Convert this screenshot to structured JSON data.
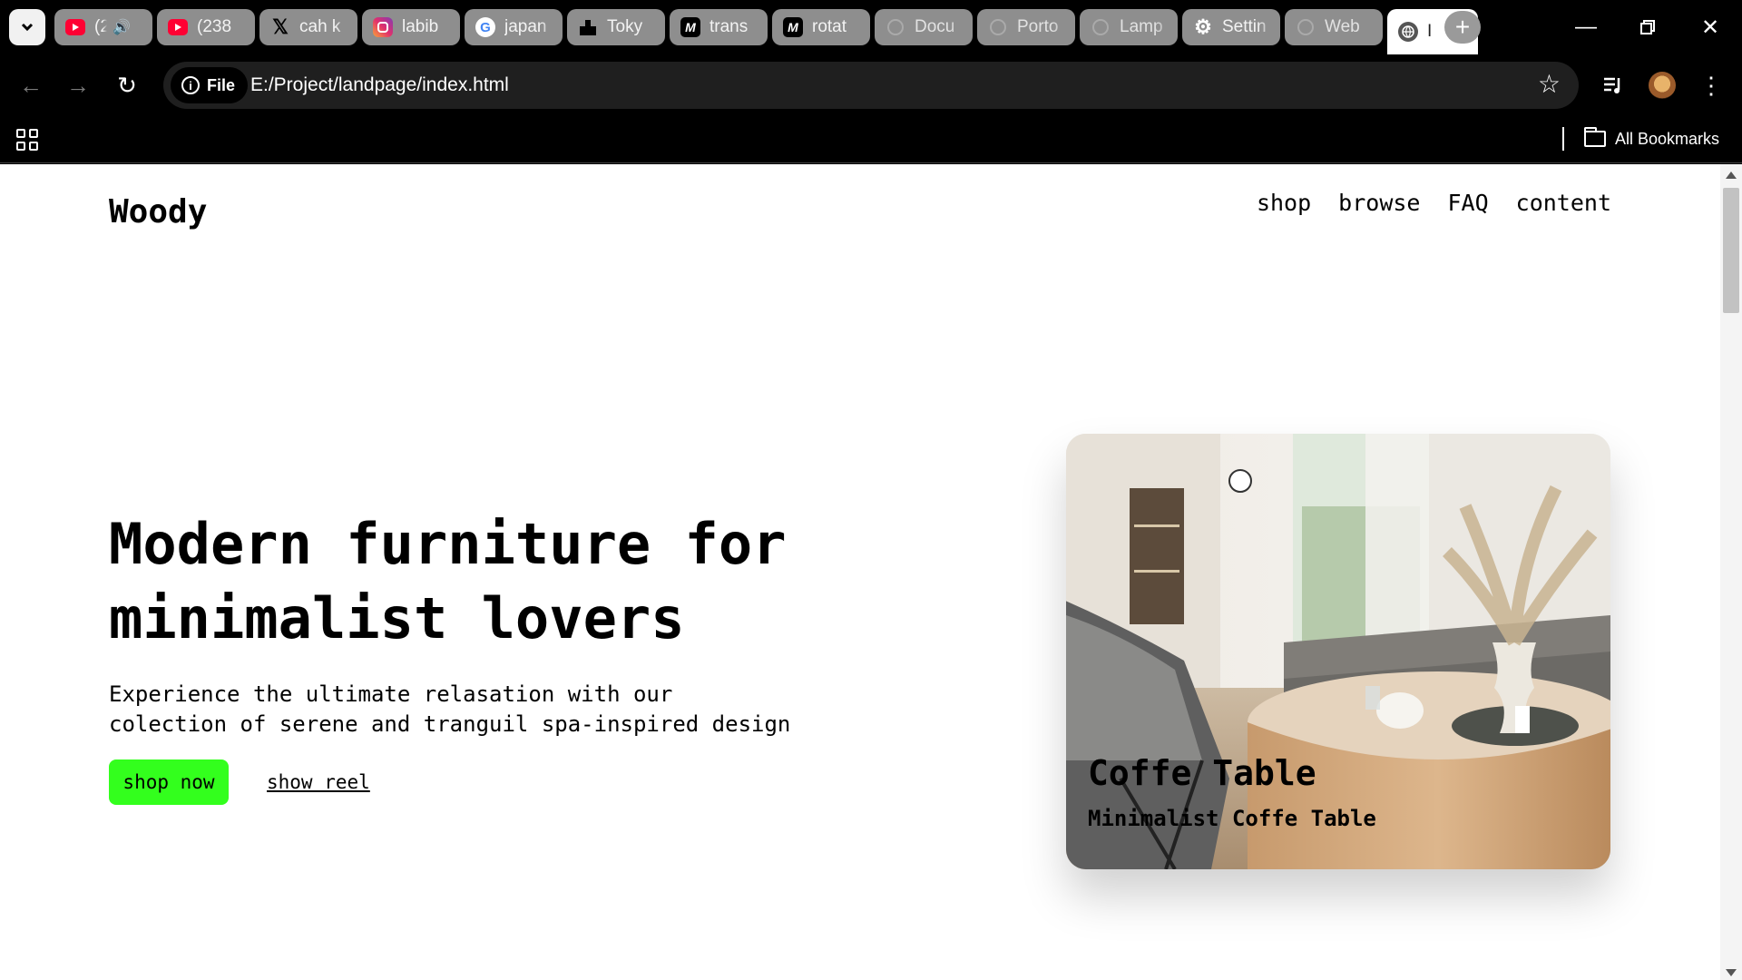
{
  "browser": {
    "tabs": [
      {
        "title": "(2",
        "icon": "youtube-icon",
        "audio": true
      },
      {
        "title": "(238",
        "icon": "youtube-icon"
      },
      {
        "title": "cah k",
        "icon": "x-logo-icon"
      },
      {
        "title": "labib",
        "icon": "instagram-icon"
      },
      {
        "title": "japan",
        "icon": "google-icon"
      },
      {
        "title": "Toky",
        "icon": "site-icon"
      },
      {
        "title": "trans",
        "icon": "m-logo-icon"
      },
      {
        "title": "rotat",
        "icon": "m-logo-icon"
      },
      {
        "title": "Docu",
        "icon": "globe-icon"
      },
      {
        "title": "Porto",
        "icon": "globe-icon"
      },
      {
        "title": "Lamp",
        "icon": "globe-icon"
      },
      {
        "title": "Settin",
        "icon": "gear-icon"
      },
      {
        "title": "Web",
        "icon": "globe-icon"
      },
      {
        "title": "I",
        "icon": "globe-icon",
        "active": true
      }
    ],
    "address": {
      "chip_label": "File",
      "url": "E:/Project/landpage/index.html"
    },
    "bookmarks": {
      "all_label": "All Bookmarks"
    }
  },
  "site": {
    "brand": "Woody",
    "nav": [
      "shop",
      "browse",
      "FAQ",
      "content"
    ],
    "hero": {
      "title_line1": "Modern furniture for",
      "title_line2": "minimalist lovers",
      "subtitle_line1": "Experience the ultimate relasation with our",
      "subtitle_line2": "colection of serene and tranguil spa-inspired design",
      "primary_cta": "shop now",
      "secondary_cta": "show reel"
    },
    "card": {
      "title": "Coffe Table",
      "subtitle": "Minimalist Coffe Table"
    },
    "colors": {
      "accent": "#33ff1d"
    }
  }
}
